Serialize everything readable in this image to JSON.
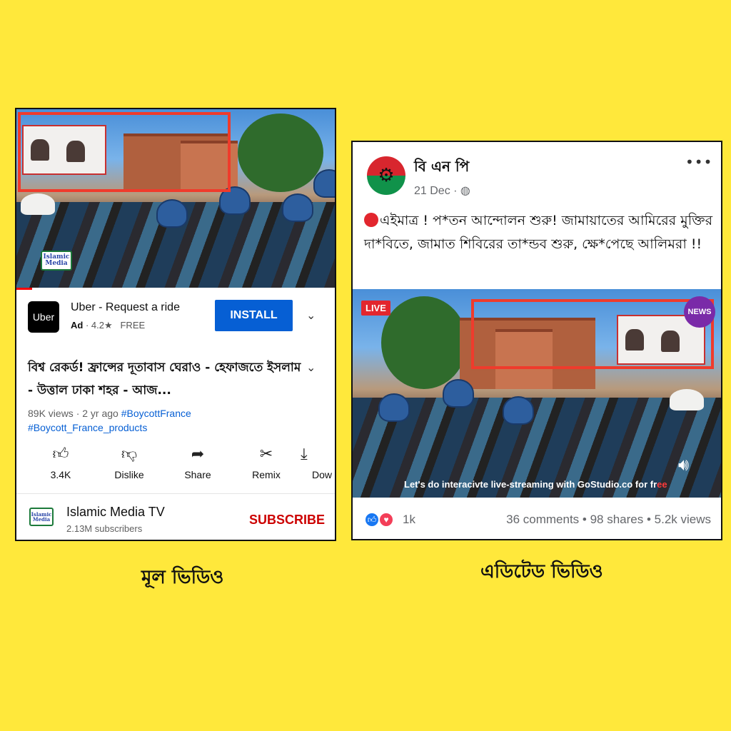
{
  "colors": {
    "background": "#ffe83b",
    "highlight": "#ef3b2c",
    "install": "#065fd4",
    "subscribe": "#cc0000"
  },
  "youtube": {
    "channel_logo": {
      "line1": "Islamic",
      "line2": "Media"
    },
    "ad": {
      "logo": "Uber",
      "title": "Uber - Request a ride",
      "ad_label": "Ad",
      "rating": "· 4.2★",
      "price": "FREE",
      "install_label": "INSTALL",
      "expand_icon": "chevron-down-icon"
    },
    "video": {
      "title": "বিশ্ব রেকর্ড! ফ্রান্সের দূতাবাস ঘেরাও - হেফাজতে ইসলাম - উত্তাল ঢাকা শহর - আজ...",
      "meta": "89K views · 2 yr ago",
      "tag1": "#BoycottFrance",
      "tag2": "#Boycott_France_products"
    },
    "actions": [
      {
        "icon": "thumbs-up-icon",
        "label": "3.4K"
      },
      {
        "icon": "thumbs-down-icon",
        "label": "Dislike"
      },
      {
        "icon": "share-icon",
        "label": "Share"
      },
      {
        "icon": "remix-icon",
        "label": "Remix"
      },
      {
        "icon": "download-icon",
        "label": "Dow"
      }
    ],
    "channel": {
      "name": "Islamic Media TV",
      "subscribers": "2.13M subscribers",
      "subscribe_label": "SUBSCRIBE"
    }
  },
  "facebook": {
    "page_name": "বি এন পি",
    "date": "21 Dec ·",
    "privacy_icon": "globe-icon",
    "post_text": "এইমাত্র ! প*তন আন্দোলন শুরু!  জামায়াতের আমিরের মুক্তির দা*বিতে, জামাত শিবিরের তা*ন্ডব শুরু,  ক্ষে*পেছে  আলিমরা !!",
    "live_label": "LIVE",
    "news_badge": "NEWS",
    "ticker_text": "Let's do interacivte live-streaming with GoStudio.co for fr",
    "ticker_tail": "ee",
    "reactions_count": "1k",
    "stats": "36 comments • 98 shares • 5.2k views"
  },
  "captions": {
    "left": "মূল ভিডিও",
    "right": "এডিটেড ভিডিও"
  }
}
